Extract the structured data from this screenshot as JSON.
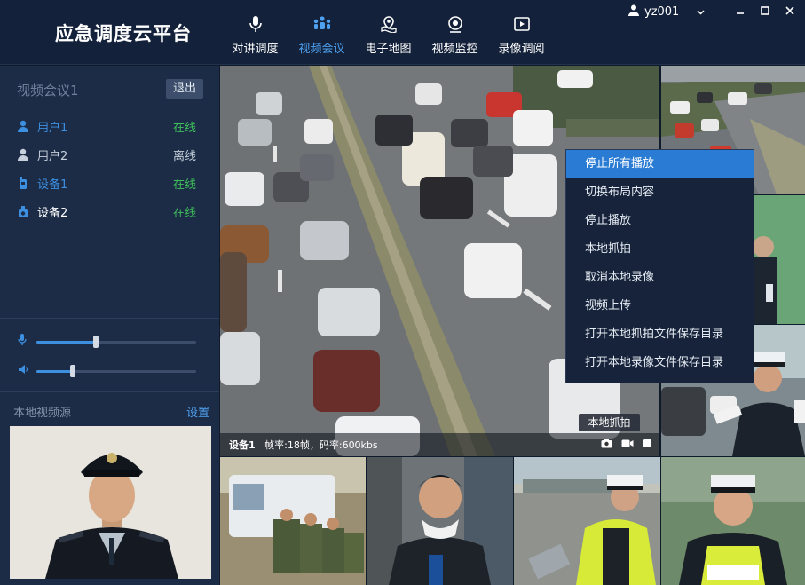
{
  "app": {
    "title": "应急调度云平台"
  },
  "nav": {
    "items": [
      {
        "label": "对讲调度",
        "icon": "microphone-icon"
      },
      {
        "label": "视频会议",
        "icon": "conference-icon"
      },
      {
        "label": "电子地图",
        "icon": "map-icon"
      },
      {
        "label": "视频监控",
        "icon": "camera-icon"
      },
      {
        "label": "录像调阅",
        "icon": "playback-icon"
      }
    ],
    "active_index": 1
  },
  "user": {
    "name": "yz001"
  },
  "conference": {
    "title": "视频会议1",
    "exit_label": "退出",
    "members": [
      {
        "name": "用户1",
        "status": "在线",
        "icon": "user-icon",
        "color": "#3d8fe0",
        "status_color": "#3fbf5a"
      },
      {
        "name": "用户2",
        "status": "离线",
        "icon": "user-icon",
        "color": "#c7d0dc",
        "status_color": "#c7d0dc"
      },
      {
        "name": "设备1",
        "status": "在线",
        "icon": "radio-device-icon",
        "color": "#3d8fe0",
        "status_color": "#3fbf5a"
      },
      {
        "name": "设备2",
        "status": "在线",
        "icon": "camera-device-icon",
        "color": "#ffffff",
        "status_color": "#3fbf5a"
      }
    ]
  },
  "audio": {
    "mic_level": 0.37,
    "speaker_level": 0.23
  },
  "local_video": {
    "label": "本地视频源",
    "settings_label": "设置"
  },
  "main_tile": {
    "caption_device": "设备1",
    "caption_stats": "帧率:18帧，码率:600kbs",
    "snapshot_tooltip": "本地抓拍"
  },
  "context_menu": {
    "items": [
      "停止所有播放",
      "切换布局内容",
      "停止播放",
      "本地抓拍",
      "取消本地录像",
      "视频上传",
      "打开本地抓拍文件保存目录",
      "打开本地录像文件保存目录"
    ],
    "highlighted_index": 0
  },
  "colors": {
    "accent": "#3d8fe0",
    "online": "#3fbf5a",
    "menu_highlight": "#2a7bd4"
  }
}
